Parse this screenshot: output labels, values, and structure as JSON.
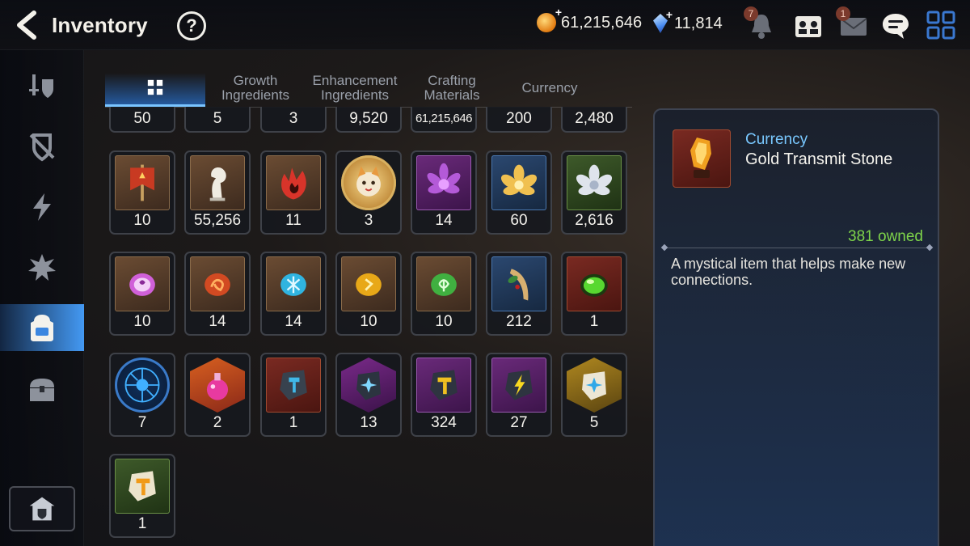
{
  "header": {
    "title": "Inventory",
    "help_symbol": "?",
    "gold": "61,215,646",
    "crystals": "11,814",
    "notifications_badge": "7",
    "mail_badge": "1"
  },
  "tabs": [
    {
      "label": "",
      "icon": "grid-icon",
      "active": true
    },
    {
      "label": "Growth Ingredients"
    },
    {
      "label": "Enhancement Ingredients"
    },
    {
      "label": "Crafting Materials"
    },
    {
      "label": "Currency"
    }
  ],
  "items": {
    "row0": [
      "50",
      "5",
      "3",
      "9,520",
      "61,215,646",
      "200",
      "2,480"
    ],
    "row1": [
      "10",
      "55,256",
      "11",
      "3",
      "14",
      "60",
      "2,616"
    ],
    "row2": [
      "10",
      "14",
      "14",
      "10",
      "10",
      "212",
      "1"
    ],
    "row3": [
      "7",
      "2",
      "1",
      "13",
      "324",
      "27",
      "5"
    ],
    "row4": [
      "1"
    ]
  },
  "detail": {
    "category": "Currency",
    "name": "Gold Transmit Stone",
    "owned": "381 owned",
    "description": "A mystical item that helps make new connections."
  },
  "colors": {
    "accent_blue": "#79c8ff",
    "owned_green": "#7ed44a",
    "active_sidebar": "#46a0ff"
  }
}
